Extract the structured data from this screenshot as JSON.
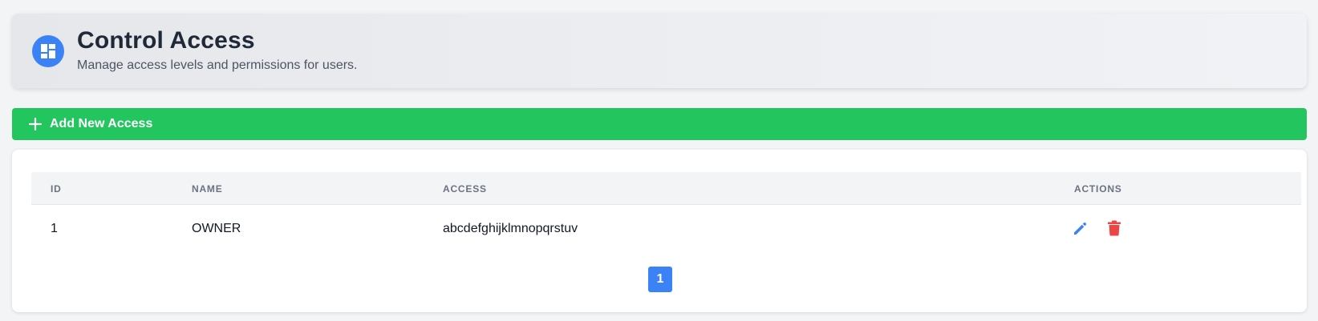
{
  "header": {
    "icon": "dashboard-icon",
    "title": "Control Access",
    "subtitle": "Manage access levels and permissions for users."
  },
  "add_button": {
    "icon": "plus-icon",
    "label": "Add New Access"
  },
  "table": {
    "columns": [
      "ID",
      "NAME",
      "ACCESS",
      "ACTIONS"
    ],
    "rows": [
      {
        "id": "1",
        "name": "OWNER",
        "access": "abcdefghijklmnopqrstuv",
        "actions": [
          "edit-icon",
          "delete-icon"
        ]
      }
    ]
  },
  "pagination": {
    "current_page": "1"
  },
  "colors": {
    "primary": "#3b82f6",
    "success": "#22c55e",
    "danger": "#ef4444"
  }
}
